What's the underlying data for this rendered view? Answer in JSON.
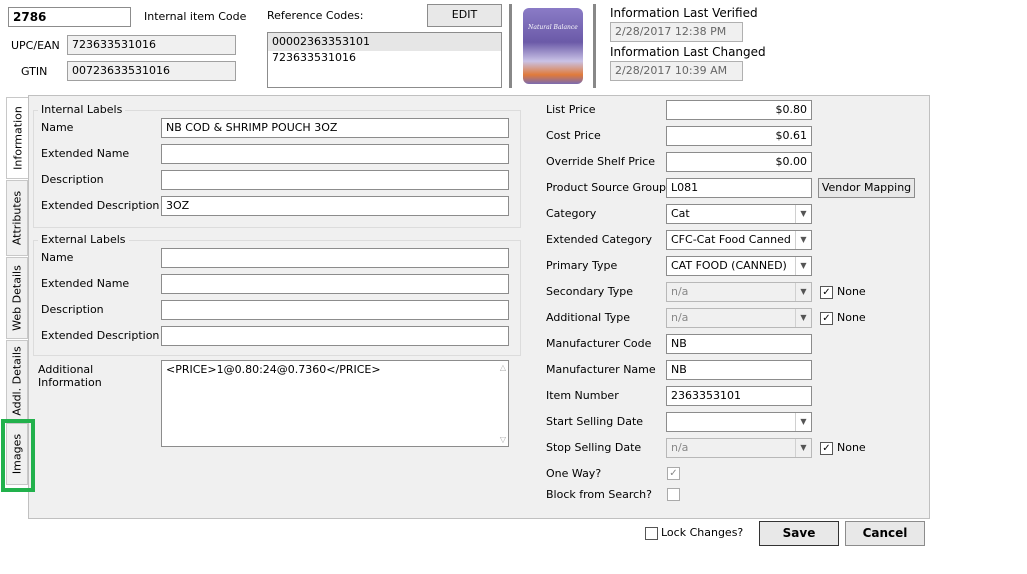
{
  "header": {
    "item_id": "2786",
    "internal_item_code_label": "Internal item Code",
    "upc_label": "UPC/EAN",
    "upc_value": "723633531016",
    "gtin_label": "GTIN",
    "gtin_value": "00723633531016",
    "reference_codes_label": "Reference Codes:",
    "edit_label": "EDIT",
    "reference_codes": [
      "00002363353101",
      "723633531016"
    ],
    "product_image_text": "Natural Balance",
    "info_verified_label": "Information Last Verified",
    "info_verified_value": "2/28/2017 12:38 PM",
    "info_changed_label": "Information Last Changed",
    "info_changed_value": "2/28/2017 10:39 AM"
  },
  "tabs": [
    "Information",
    "Attributes",
    "Web Details",
    "Addl. Details",
    "Images"
  ],
  "internal_labels": {
    "title": "Internal Labels",
    "name_label": "Name",
    "name_value": "NB COD & SHRIMP POUCH 3OZ",
    "ext_name_label": "Extended Name",
    "ext_name_value": "",
    "desc_label": "Description",
    "desc_value": "",
    "ext_desc_label": "Extended Description",
    "ext_desc_value": "3OZ"
  },
  "external_labels": {
    "title": "External Labels",
    "name_label": "Name",
    "name_value": "",
    "ext_name_label": "Extended Name",
    "ext_name_value": "",
    "desc_label": "Description",
    "desc_value": "",
    "ext_desc_label": "Extended Description",
    "ext_desc_value": ""
  },
  "additional_info": {
    "label_line1": "Additional",
    "label_line2": "Information",
    "value": "<PRICE>1@0.80:24@0.7360</PRICE>"
  },
  "right": {
    "list_price_label": "List Price",
    "list_price": "$0.80",
    "cost_price_label": "Cost Price",
    "cost_price": "$0.61",
    "override_label": "Override Shelf Price",
    "override_price": "$0.00",
    "psg_label": "Product Source Group",
    "psg_value": "L081",
    "vendor_mapping_label": "Vendor Mapping",
    "category_label": "Category",
    "category_value": "Cat",
    "ext_category_label": "Extended Category",
    "ext_category_value": "CFC-Cat Food Canned",
    "primary_type_label": "Primary Type",
    "primary_type_value": "CAT FOOD (CANNED)",
    "secondary_type_label": "Secondary Type",
    "secondary_type_value": "n/a",
    "additional_type_label": "Additional Type",
    "additional_type_value": "n/a",
    "none_label": "None",
    "mfr_code_label": "Manufacturer Code",
    "mfr_code_value": "NB",
    "mfr_name_label": "Manufacturer Name",
    "mfr_name_value": "NB",
    "item_number_label": "Item Number",
    "item_number_value": "2363353101",
    "start_selling_label": "Start Selling Date",
    "start_selling_value": "",
    "stop_selling_label": "Stop Selling Date",
    "stop_selling_value": "n/a",
    "one_way_label": "One Way?",
    "block_search_label": "Block from Search?"
  },
  "footer": {
    "lock_changes_label": "Lock Changes?",
    "save_label": "Save",
    "cancel_label": "Cancel"
  },
  "colors": {
    "highlight_green": "#22b14c"
  }
}
